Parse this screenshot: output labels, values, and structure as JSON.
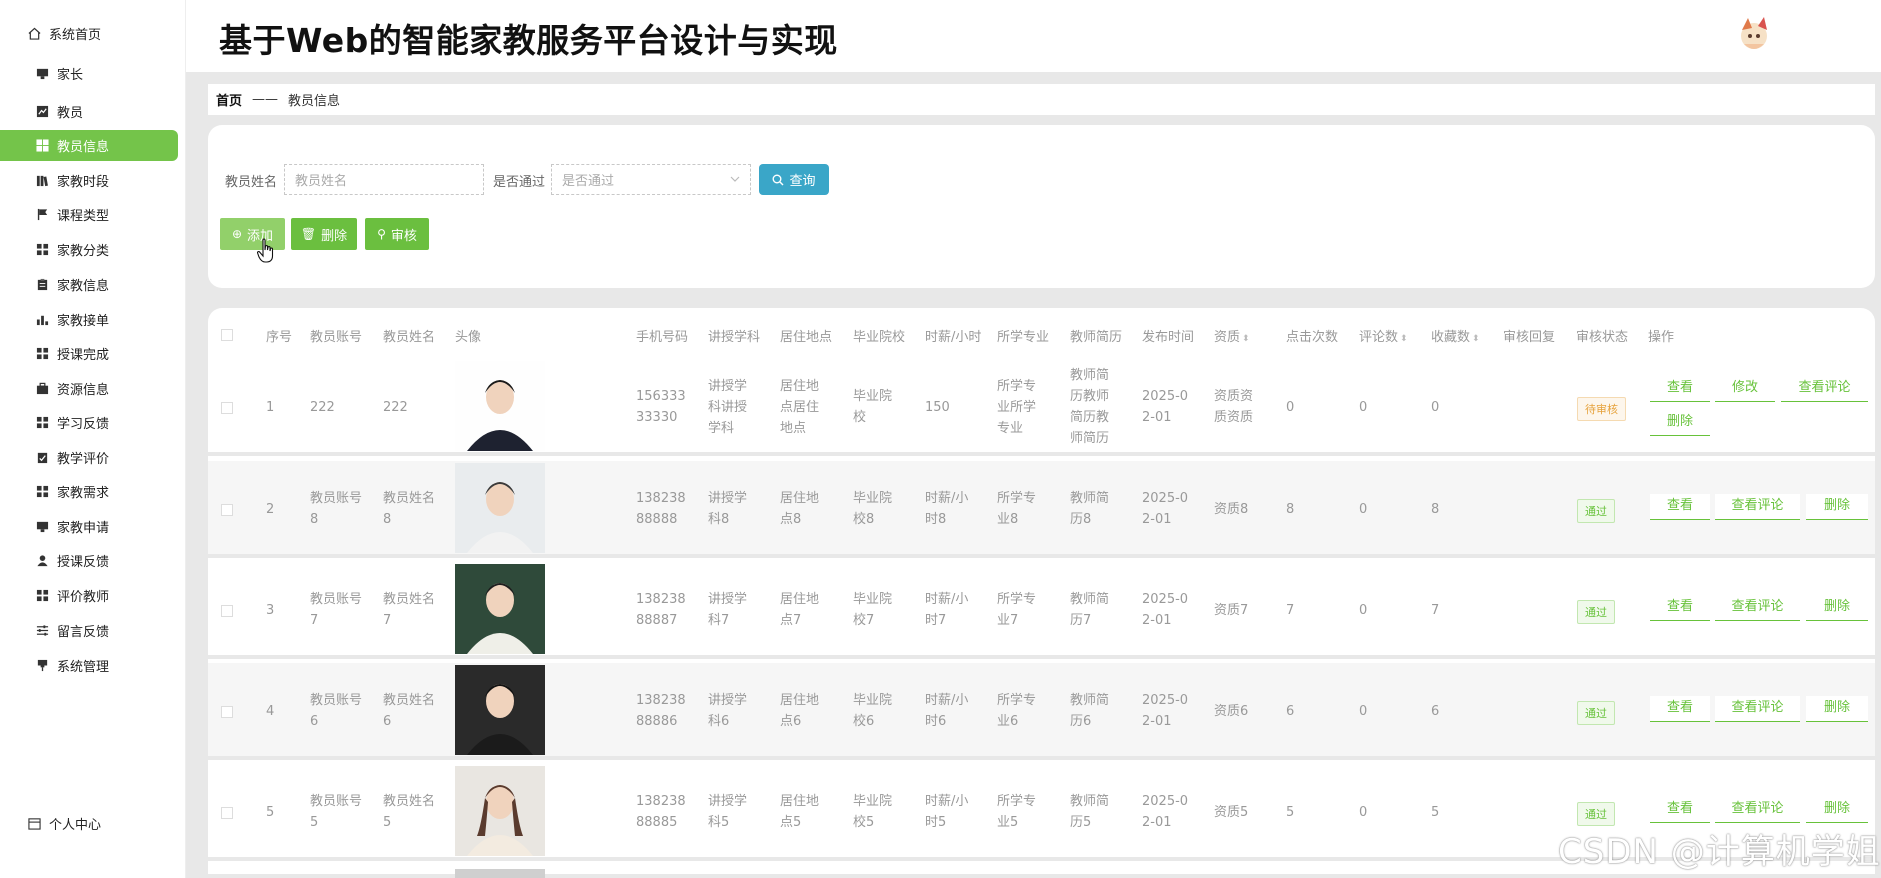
{
  "sidebar": {
    "home": "系统首页",
    "items": [
      {
        "label": "家长",
        "icon": "monitor-icon"
      },
      {
        "label": "教员",
        "icon": "chart-icon"
      },
      {
        "label": "教员信息",
        "icon": "grid-icon",
        "active": true
      },
      {
        "label": "家教时段",
        "icon": "books-icon"
      },
      {
        "label": "课程类型",
        "icon": "flag-icon"
      },
      {
        "label": "家教分类",
        "icon": "grid-icon"
      },
      {
        "label": "家教信息",
        "icon": "clipboard-icon"
      },
      {
        "label": "家教接单",
        "icon": "bars-icon"
      },
      {
        "label": "授课完成",
        "icon": "grid-icon"
      },
      {
        "label": "资源信息",
        "icon": "briefcase-icon"
      },
      {
        "label": "学习反馈",
        "icon": "grid-icon"
      },
      {
        "label": "教学评价",
        "icon": "clipboard-check-icon"
      },
      {
        "label": "家教需求",
        "icon": "grid-icon"
      },
      {
        "label": "家教申请",
        "icon": "monitor-icon"
      },
      {
        "label": "授课反馈",
        "icon": "user-icon"
      },
      {
        "label": "评价教师",
        "icon": "grid-icon"
      },
      {
        "label": "留言反馈",
        "icon": "sliders-icon"
      },
      {
        "label": "系统管理",
        "icon": "pin-icon"
      }
    ],
    "personal": "个人中心"
  },
  "header": {
    "title": "基于Web的智能家教服务平台设计与实现"
  },
  "breadcrumb": {
    "home": "首页",
    "sep": "——",
    "current": "教员信息"
  },
  "search": {
    "name_label": "教员姓名",
    "name_placeholder": "教员姓名",
    "pass_label": "是否通过",
    "pass_placeholder": "是否通过",
    "query": "查询"
  },
  "actions": {
    "add": "添加",
    "delete": "删除",
    "audit": "审核"
  },
  "columns": [
    "序号",
    "教员账号",
    "教员姓名",
    "头像",
    "手机号码",
    "讲授学科",
    "居住地点",
    "毕业院校",
    "时薪/小时",
    "所学专业",
    "教师简历",
    "发布时间",
    "资质",
    "点击次数",
    "评论数",
    "收藏数",
    "审核回复",
    "审核状态",
    "操作"
  ],
  "rows": [
    {
      "no": "1",
      "account": "222",
      "name": "222",
      "phone": [
        "156333",
        "33330"
      ],
      "subject": [
        "讲授学",
        "科讲授",
        "学科"
      ],
      "addr": [
        "居住地",
        "点居住",
        "地点"
      ],
      "school": [
        "毕业院",
        "校"
      ],
      "wage": [
        "150"
      ],
      "major": [
        "所学专",
        "业所学",
        "专业"
      ],
      "resume": [
        "教师简",
        "历教师",
        "简历教",
        "师简历"
      ],
      "time": [
        "2025-0",
        "2-01"
      ],
      "qual": [
        "资质资",
        "质资质"
      ],
      "clicks": "0",
      "comments": "0",
      "favs": "0",
      "status": "待审核",
      "ops": [
        "查看",
        "修改",
        "查看评论",
        "删除"
      ]
    },
    {
      "no": "2",
      "account": "教员账号8",
      "name": "教员姓名8",
      "phone": [
        "138238",
        "88888"
      ],
      "subject": [
        "讲授学",
        "科8"
      ],
      "addr": [
        "居住地",
        "点8"
      ],
      "school": [
        "毕业院",
        "校8"
      ],
      "wage": [
        "时薪/小",
        "时8"
      ],
      "major": [
        "所学专",
        "业8"
      ],
      "resume": [
        "教师简",
        "历8"
      ],
      "time": [
        "2025-0",
        "2-01"
      ],
      "qual": [
        "资质8"
      ],
      "clicks": "8",
      "comments": "0",
      "favs": "8",
      "status": "通过",
      "ops": [
        "查看",
        "查看评论",
        "删除"
      ]
    },
    {
      "no": "3",
      "account": "教员账号7",
      "name": "教员姓名7",
      "phone": [
        "138238",
        "88887"
      ],
      "subject": [
        "讲授学",
        "科7"
      ],
      "addr": [
        "居住地",
        "点7"
      ],
      "school": [
        "毕业院",
        "校7"
      ],
      "wage": [
        "时薪/小",
        "时7"
      ],
      "major": [
        "所学专",
        "业7"
      ],
      "resume": [
        "教师简",
        "历7"
      ],
      "time": [
        "2025-0",
        "2-01"
      ],
      "qual": [
        "资质7"
      ],
      "clicks": "7",
      "comments": "0",
      "favs": "7",
      "status": "通过",
      "ops": [
        "查看",
        "查看评论",
        "删除"
      ]
    },
    {
      "no": "4",
      "account": "教员账号6",
      "name": "教员姓名6",
      "phone": [
        "138238",
        "88886"
      ],
      "subject": [
        "讲授学",
        "科6"
      ],
      "addr": [
        "居住地",
        "点6"
      ],
      "school": [
        "毕业院",
        "校6"
      ],
      "wage": [
        "时薪/小",
        "时6"
      ],
      "major": [
        "所学专",
        "业6"
      ],
      "resume": [
        "教师简",
        "历6"
      ],
      "time": [
        "2025-0",
        "2-01"
      ],
      "qual": [
        "资质6"
      ],
      "clicks": "6",
      "comments": "0",
      "favs": "6",
      "status": "通过",
      "ops": [
        "查看",
        "查看评论",
        "删除"
      ]
    },
    {
      "no": "5",
      "account": "教员账号5",
      "name": "教员姓名5",
      "phone": [
        "138238",
        "88885"
      ],
      "subject": [
        "讲授学",
        "科5"
      ],
      "addr": [
        "居住地",
        "点5"
      ],
      "school": [
        "毕业院",
        "校5"
      ],
      "wage": [
        "时薪/小",
        "时5"
      ],
      "major": [
        "所学专",
        "业5"
      ],
      "resume": [
        "教师简",
        "历5"
      ],
      "time": [
        "2025-0",
        "2-01"
      ],
      "qual": [
        "资质5"
      ],
      "clicks": "5",
      "comments": "0",
      "favs": "5",
      "status": "通过",
      "ops": [
        "查看",
        "查看评论",
        "删除"
      ]
    }
  ],
  "watermark": "CSDN @计算机学姐",
  "colors": {
    "accent": "#74c44a",
    "query": "#3aa6c8",
    "pass": "#67c23a",
    "wait": "#e6a23c"
  }
}
